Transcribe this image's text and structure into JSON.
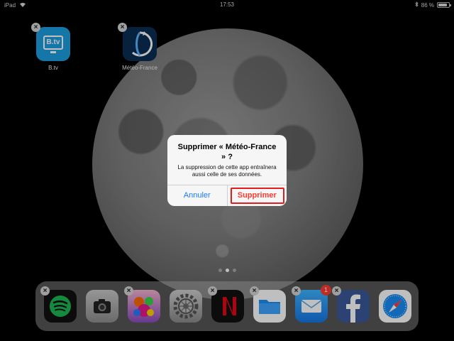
{
  "status_bar": {
    "device": "iPad",
    "time": "17:53",
    "battery": "86 %",
    "battery_level": 0.86,
    "icons": [
      "wifi-icon",
      "bluetooth-icon",
      "battery-icon"
    ]
  },
  "home": {
    "apps": [
      {
        "label": "B.tv",
        "icon_text": "B.tv",
        "icon": "btv-icon",
        "color": "#1d9ee0"
      },
      {
        "label": "Météo-France",
        "icon": "meteo-france-icon",
        "color": "#0a2e55"
      }
    ],
    "page_dots": 3,
    "active_page": 2
  },
  "dock": {
    "apps": [
      {
        "name": "Spotify",
        "icon": "spotify-icon",
        "color": "#1db954"
      },
      {
        "name": "Camera",
        "icon": "camera-icon"
      },
      {
        "name": "Candy Crush",
        "icon": "candy-icon"
      },
      {
        "name": "Settings",
        "icon": "settings-icon"
      },
      {
        "name": "Netflix",
        "icon": "netflix-icon",
        "color": "#e50914"
      },
      {
        "name": "Files",
        "icon": "files-icon",
        "color": "#1f8ff0"
      },
      {
        "name": "Mail",
        "icon": "mail-icon",
        "badge": "1"
      },
      {
        "name": "Facebook",
        "icon": "facebook-icon",
        "color": "#3b5998"
      },
      {
        "name": "Safari",
        "icon": "safari-icon",
        "color": "#1a8cf5"
      }
    ]
  },
  "dialog": {
    "title": "Supprimer « Météo-France » ?",
    "message": "La suppression de cette app entraînera aussi celle de ses données.",
    "cancel_label": "Annuler",
    "confirm_label": "Supprimer",
    "accent_color": "#1a7cf5",
    "destructive_color": "#ff3b30",
    "highlight_color": "#e21d1d"
  }
}
